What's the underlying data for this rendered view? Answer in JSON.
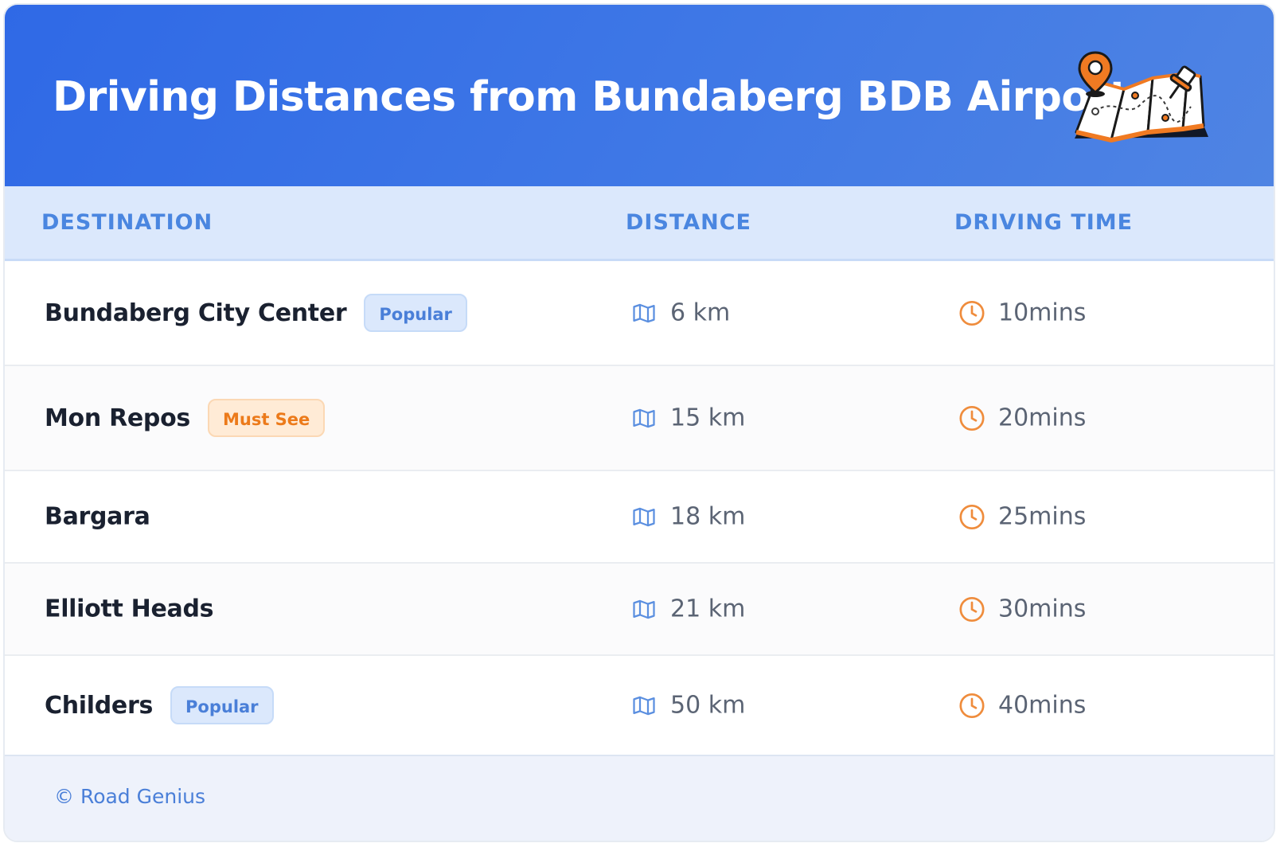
{
  "header": {
    "title": "Driving Distances from Bundaberg BDB Airport",
    "illustration_icon": "folded-map-with-pins-icon"
  },
  "table": {
    "columns": [
      "DESTINATION",
      "DISTANCE",
      "DRIVING TIME"
    ],
    "rows": [
      {
        "destination": "Bundaberg City Center",
        "badge": "Popular",
        "badge_style": "blue",
        "distance": "6 km",
        "time": "10mins"
      },
      {
        "destination": "Mon Repos",
        "badge": "Must See",
        "badge_style": "orange",
        "distance": "15 km",
        "time": "20mins"
      },
      {
        "destination": "Bargara",
        "badge": "",
        "badge_style": "",
        "distance": "18 km",
        "time": "25mins"
      },
      {
        "destination": "Elliott Heads",
        "badge": "",
        "badge_style": "",
        "distance": "21 km",
        "time": "30mins"
      },
      {
        "destination": "Childers",
        "badge": "Popular",
        "badge_style": "blue",
        "distance": "50 km",
        "time": "40mins"
      }
    ],
    "distance_icon": "map-icon",
    "time_icon": "clock-icon"
  },
  "footer": {
    "text": "© Road Genius"
  },
  "colors": {
    "header_gradient_start": "#2f69e6",
    "header_gradient_end": "#4f84e3",
    "accent_blue": "#4a86e0",
    "accent_orange": "#ec7a1a",
    "table_header_bg": "#dbe8fc"
  }
}
